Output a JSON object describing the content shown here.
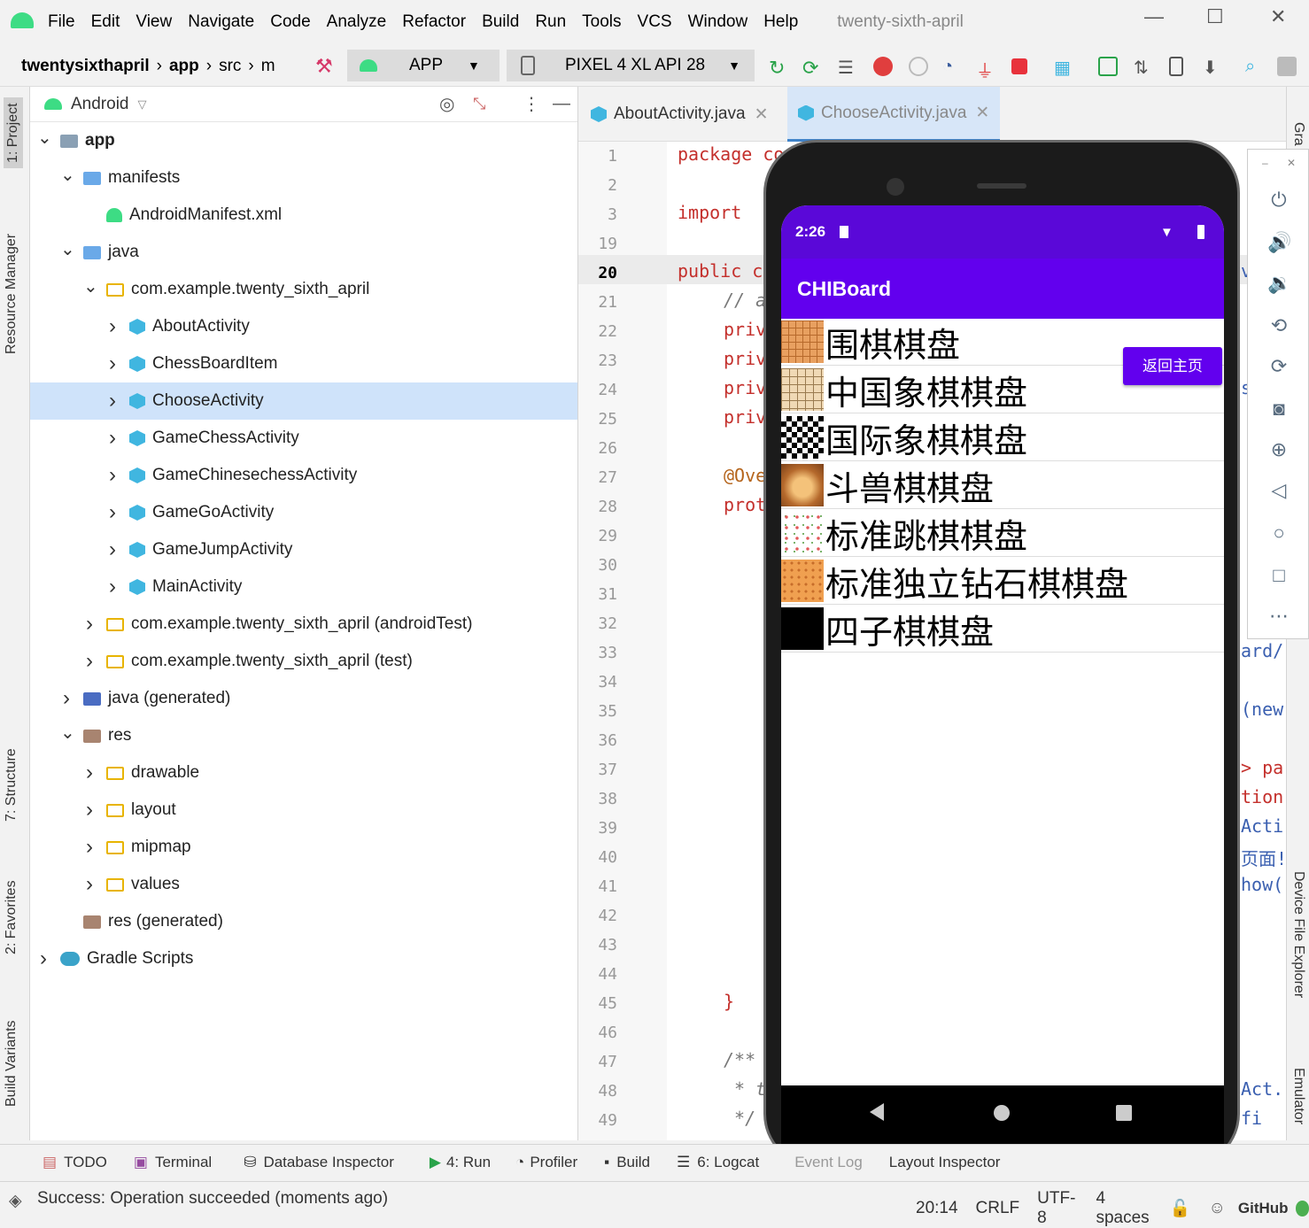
{
  "menu": {
    "items": [
      "File",
      "Edit",
      "View",
      "Navigate",
      "Code",
      "Analyze",
      "Refactor",
      "Build",
      "Run",
      "Tools",
      "VCS",
      "Window",
      "Help"
    ],
    "project_title": "twenty-sixth-april"
  },
  "toolbar": {
    "breadcrumb": [
      "twentysixthapril",
      "app",
      "src",
      "m"
    ],
    "run_config": "APP",
    "device": "PIXEL 4 XL API 28"
  },
  "left_tabs": [
    "1: Project",
    "Resource Manager",
    "7: Structure",
    "2: Favorites",
    "Build Variants"
  ],
  "right_tabs": [
    "Gra",
    "Device File Explorer",
    "Emulator"
  ],
  "project_panel": {
    "view_label": "Android",
    "tree": [
      {
        "label": "app",
        "level": 0,
        "expanded": true,
        "icon": "module-folder-icon"
      },
      {
        "label": "manifests",
        "level": 1,
        "expanded": true,
        "icon": "folder-icon"
      },
      {
        "label": "AndroidManifest.xml",
        "level": 2,
        "icon": "android-icon"
      },
      {
        "label": "java",
        "level": 1,
        "expanded": true,
        "icon": "folder-icon"
      },
      {
        "label": "com.example.twenty_sixth_april",
        "level": 2,
        "expanded": true,
        "icon": "package-icon"
      },
      {
        "label": "AboutActivity",
        "level": 3,
        "icon": "class-icon"
      },
      {
        "label": "ChessBoardItem",
        "level": 3,
        "icon": "class-icon"
      },
      {
        "label": "ChooseActivity",
        "level": 3,
        "icon": "class-icon",
        "selected": true
      },
      {
        "label": "GameChessActivity",
        "level": 3,
        "icon": "class-icon"
      },
      {
        "label": "GameChinesechessActivity",
        "level": 3,
        "icon": "class-icon"
      },
      {
        "label": "GameGoActivity",
        "level": 3,
        "icon": "class-icon"
      },
      {
        "label": "GameJumpActivity",
        "level": 3,
        "icon": "class-icon"
      },
      {
        "label": "MainActivity",
        "level": 3,
        "icon": "class-icon"
      },
      {
        "label": "com.example.twenty_sixth_april (androidTest)",
        "level": 2,
        "icon": "package-icon"
      },
      {
        "label": "com.example.twenty_sixth_april (test)",
        "level": 2,
        "icon": "package-icon"
      },
      {
        "label": "java (generated)",
        "level": 1,
        "icon": "generated-folder-icon"
      },
      {
        "label": "res",
        "level": 1,
        "expanded": true,
        "icon": "res-folder-icon"
      },
      {
        "label": "drawable",
        "level": 2,
        "icon": "package-icon"
      },
      {
        "label": "layout",
        "level": 2,
        "icon": "package-icon"
      },
      {
        "label": "mipmap",
        "level": 2,
        "icon": "package-icon"
      },
      {
        "label": "values",
        "level": 2,
        "icon": "package-icon"
      },
      {
        "label": "res (generated)",
        "level": 1,
        "icon": "res-folder-icon"
      },
      {
        "label": "Gradle Scripts",
        "level": 0,
        "icon": "gradle-icon"
      }
    ]
  },
  "editor": {
    "tabs": [
      {
        "label": "AboutActivity.java",
        "active": false
      },
      {
        "label": "ChooseActivity.java",
        "active": true
      }
    ],
    "line_numbers": [
      "1",
      "2",
      "3",
      "19",
      "20",
      "21",
      "22",
      "23",
      "24",
      "25",
      "26",
      "27",
      "28",
      "29",
      "30",
      "31",
      "32",
      "33",
      "34",
      "35",
      "36",
      "37",
      "38",
      "39",
      "40",
      "41",
      "42",
      "43",
      "44",
      "45",
      "46",
      "47",
      "48",
      "49"
    ],
    "current_line": "20",
    "code_fragments": {
      "l1": "package co",
      "l3": "import",
      "l20": "public c",
      "l21": "// a",
      "l22": "priv",
      "l23": "priv",
      "l24": "priv",
      "l25": "priv",
      "l27": "@Ove",
      "l28": "prot",
      "l45": "}",
      "l47": "/**",
      "l48": " * t",
      "l49": " */"
    },
    "right_fragments": [
      "v",
      "s",
      "ard/",
      "(new",
      "> pa",
      "tion",
      "Acti",
      "页面!",
      "how(",
      "Act.",
      "fi"
    ]
  },
  "emulator": {
    "time": "2:26",
    "app_title": "CHIBoard",
    "back_button": "返回主页",
    "items": [
      {
        "label": "围棋棋盘",
        "thumb": "go-board-thumb"
      },
      {
        "label": "中国象棋棋盘",
        "thumb": "xiangqi-board-thumb"
      },
      {
        "label": "国际象棋棋盘",
        "thumb": "chess-board-thumb"
      },
      {
        "label": "斗兽棋棋盘",
        "thumb": "lion-thumb"
      },
      {
        "label": "标准跳棋棋盘",
        "thumb": "star-board-thumb"
      },
      {
        "label": "标准独立钻石棋棋盘",
        "thumb": "peg-board-thumb"
      },
      {
        "label": "四子棋棋盘",
        "thumb": "black-thumb"
      }
    ]
  },
  "bottom_tools": [
    "TODO",
    "Terminal",
    "Database Inspector",
    "4: Run",
    "Profiler",
    "Build",
    "6: Logcat",
    "Event Log",
    "Layout Inspector"
  ],
  "status": {
    "message": "Success: Operation succeeded (moments ago)",
    "position": "20:14",
    "line_sep": "CRLF",
    "encoding": "UTF-8",
    "indent": "4 spaces",
    "vcs": "GitHub"
  },
  "colors": {
    "accent_purple": "#6200ee",
    "status_purple": "#5a08d8",
    "selection": "#cfe3fa",
    "keyword": "#c4302c"
  }
}
